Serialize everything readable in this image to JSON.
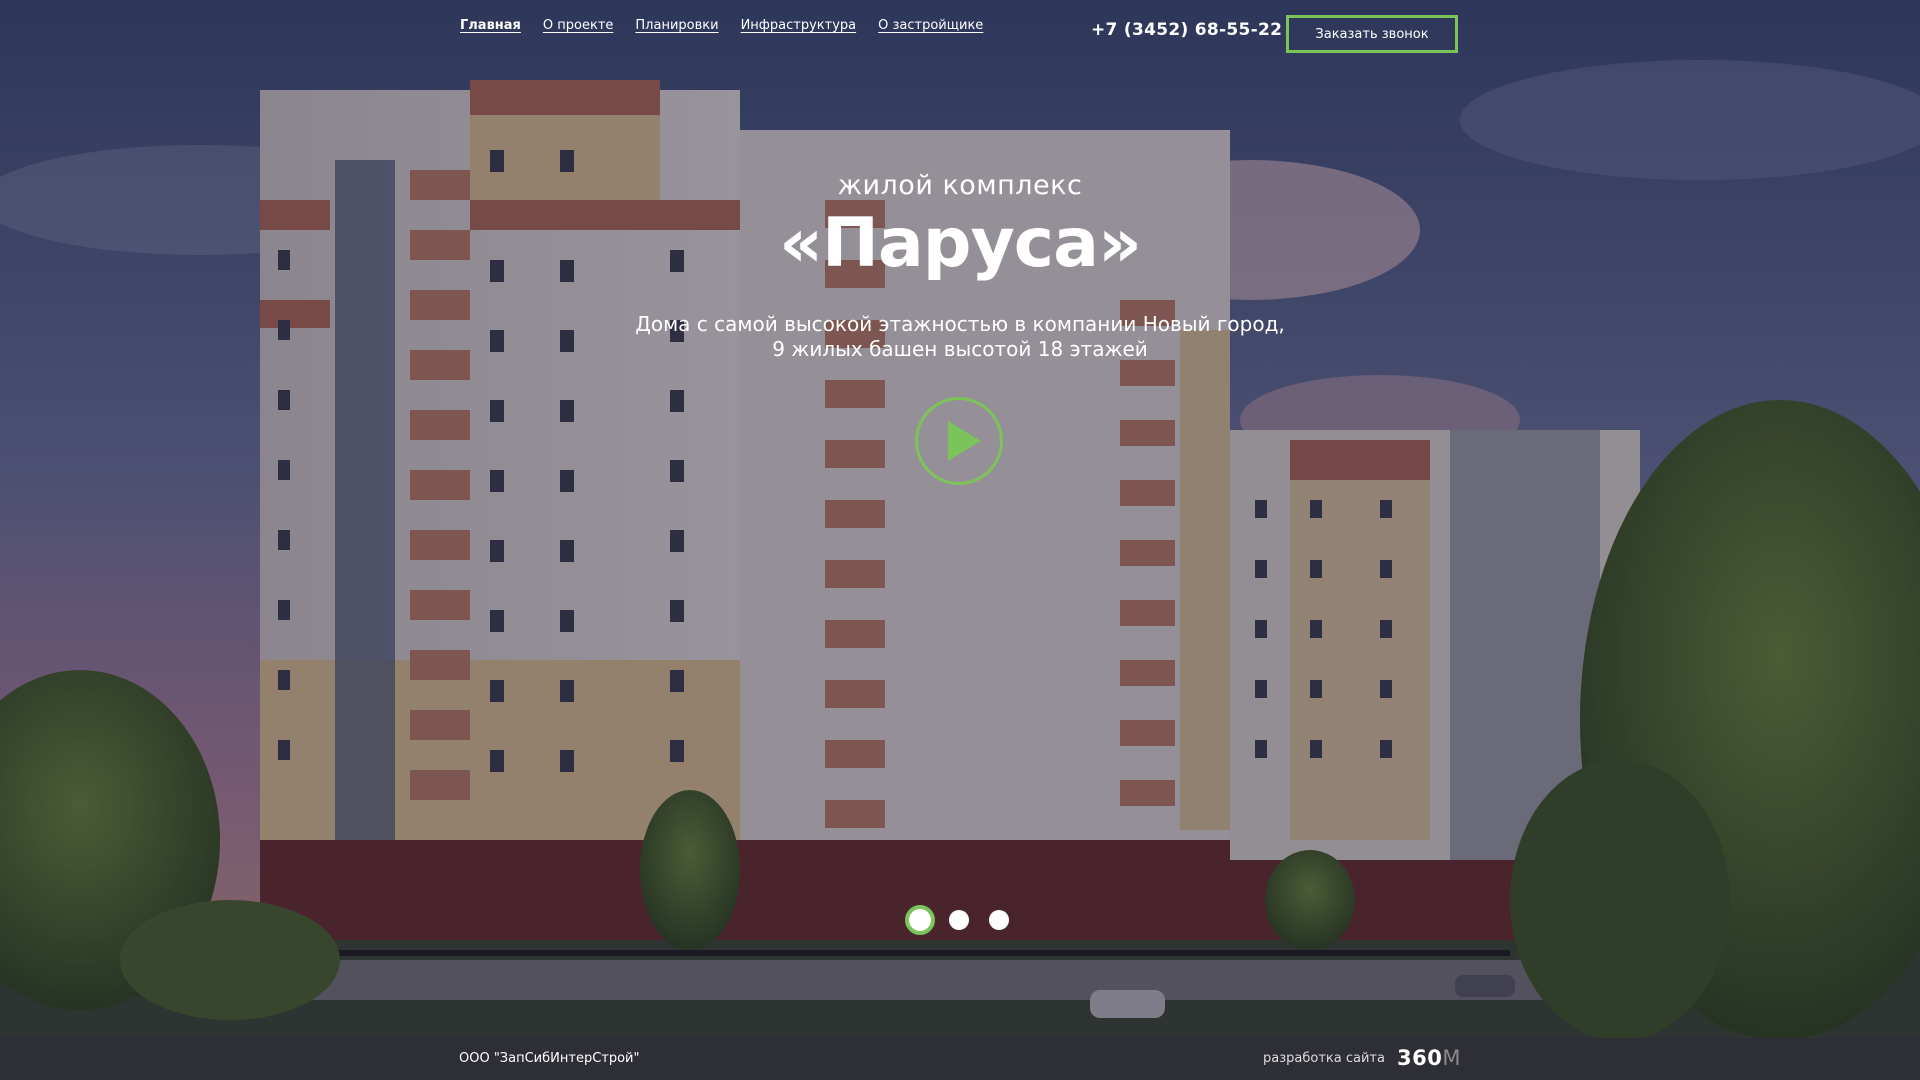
{
  "nav": {
    "items": [
      {
        "label": "Главная",
        "active": true
      },
      {
        "label": "О проекте",
        "active": false
      },
      {
        "label": "Планировки",
        "active": false
      },
      {
        "label": "Инфраструктура",
        "active": false
      },
      {
        "label": "О застройщике",
        "active": false
      }
    ]
  },
  "header": {
    "phone": "+7 (3452) 68-55-22",
    "call_button": "Заказать звонок"
  },
  "hero": {
    "subtitle": "жилой комплекс",
    "title": "«Паруса»",
    "description_line1": "Дома с самой высокой этажностью в компании Новый город,",
    "description_line2": "9 жилых башен высотой 18 этажей",
    "play_icon": "play-icon"
  },
  "slider": {
    "slide_count": 3,
    "active_slide": 1
  },
  "footer": {
    "company": "ООО \"ЗапСибИнтерСтрой\"",
    "dev_label": "разработка сайта",
    "dev_logo_main": "360",
    "dev_logo_suffix": "M"
  },
  "colors": {
    "accent": "#7cc35a",
    "footer_bg": "#2e2f36"
  }
}
